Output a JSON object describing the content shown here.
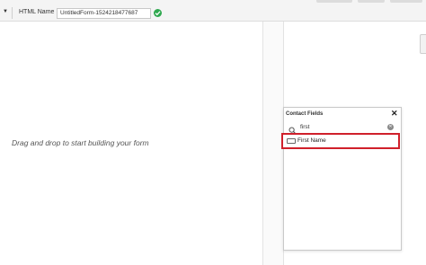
{
  "toolbar": {
    "html_name_label": "HTML Name",
    "html_name_value": "UntitledForm-1524218477687"
  },
  "canvas": {
    "placeholder": "Drag and drop to start building your form"
  },
  "contact_fields": {
    "title": "Contact Fields",
    "search_value": "first",
    "results": [
      {
        "label": "First Name"
      }
    ]
  },
  "colors": {
    "highlight": "#d0202b",
    "valid": "#2fa84f"
  }
}
